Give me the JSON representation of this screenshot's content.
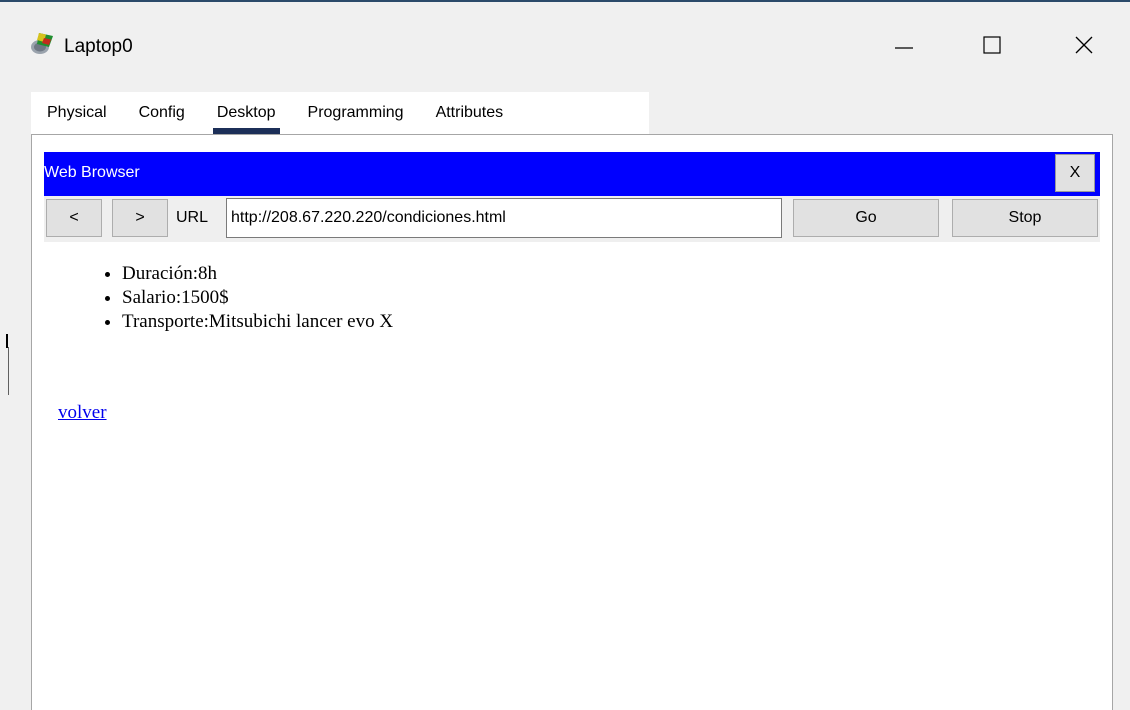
{
  "window": {
    "title": "Laptop0",
    "icon": "packet-tracer-laptop-icon",
    "controls": {
      "minimize_icon": "minimize-icon",
      "maximize_icon": "maximize-icon",
      "close_icon": "close-icon"
    }
  },
  "tabs": [
    {
      "label": "Physical"
    },
    {
      "label": "Config"
    },
    {
      "label": "Desktop",
      "active": true
    },
    {
      "label": "Programming"
    },
    {
      "label": "Attributes"
    }
  ],
  "browser": {
    "title": "Web Browser",
    "close_label": "X",
    "title_color": "#0000ff",
    "nav": {
      "back_label": "<",
      "forward_label": ">",
      "url_label": "URL",
      "url_value": "http://208.67.220.220/condiciones.html",
      "go_label": "Go",
      "stop_label": "Stop"
    },
    "page": {
      "items": [
        "Duración:8h",
        "Salario:1500$",
        "Transporte:Mitsubichi lancer evo X"
      ],
      "link_text": "volver",
      "link_color": "#0000ee"
    }
  }
}
